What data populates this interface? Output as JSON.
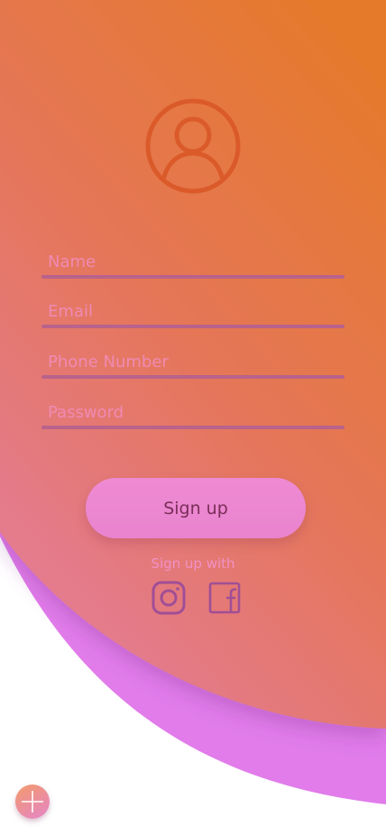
{
  "form": {
    "fields": [
      {
        "name": "name-input",
        "placeholder": "Name",
        "value": ""
      },
      {
        "name": "email-input",
        "placeholder": "Email",
        "value": ""
      },
      {
        "name": "phone-number-input",
        "placeholder": "Phone Number",
        "value": ""
      },
      {
        "name": "password-input",
        "placeholder": "Password",
        "value": ""
      }
    ],
    "submit_label": "Sign up"
  },
  "social": {
    "caption": "Sign up with",
    "icons": [
      "instagram-icon",
      "facebook-icon"
    ]
  },
  "icons": {
    "avatar": "user-avatar-icon",
    "fab": "plus-icon"
  },
  "colors": {
    "gradient_top": "#e57a2c",
    "gradient_bottom": "#e580a6",
    "accent_curve": "#e079ea",
    "button": "#ec88d1",
    "underline": "#b8628c",
    "placeholder": "#f08ab4",
    "avatar_stroke": "#db5a2a",
    "social_stroke": "#a04e96"
  }
}
